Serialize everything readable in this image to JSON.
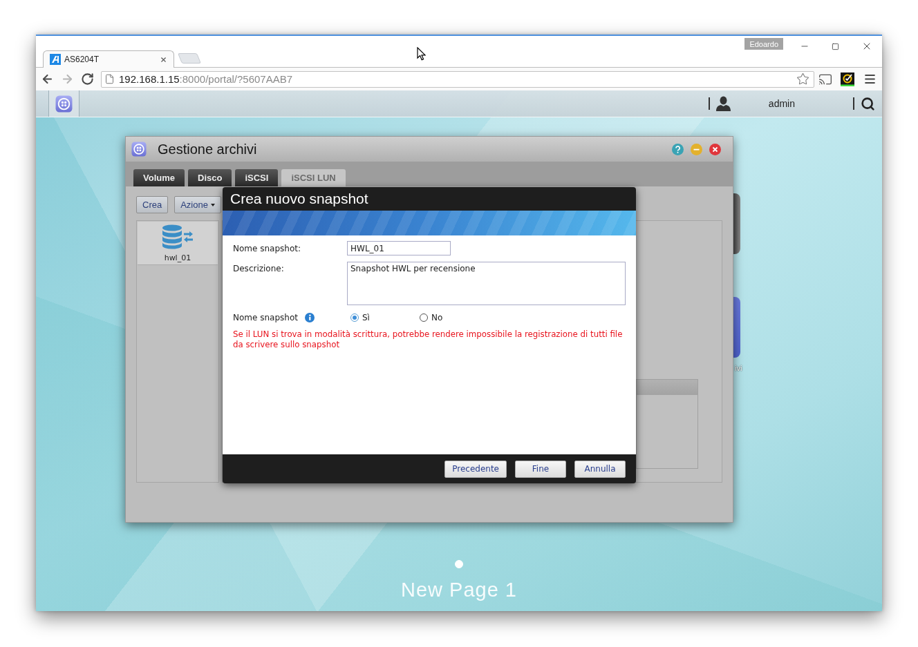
{
  "browser": {
    "tabs": [
      {
        "title": "AS6204T",
        "selected": true
      }
    ],
    "profile": "Edoardo",
    "nav": [
      {
        "kind": "back",
        "disabled": false
      },
      {
        "kind": "forward",
        "disabled": true
      },
      {
        "kind": "reload",
        "disabled": false
      }
    ],
    "url": {
      "host": "192.168.1.15",
      "path": ":8000/portal/?5607AAB7"
    }
  },
  "taskbar": {
    "user": "admin"
  },
  "window": {
    "title": "Gestione archivi",
    "tabs": [
      {
        "label": "Volume",
        "selected": false
      },
      {
        "label": "Disco",
        "selected": false
      },
      {
        "label": "iSCSI",
        "selected": false
      },
      {
        "label": "iSCSI LUN",
        "selected": true
      }
    ],
    "toolbar": [
      {
        "kind": "button",
        "label": "Crea"
      },
      {
        "kind": "menu",
        "label": "Azione"
      }
    ],
    "luns": [
      {
        "name": "hwl_01",
        "selected": true
      }
    ]
  },
  "dialog": {
    "title": "Crea nuovo snapshot",
    "fields": [
      {
        "kind": "input",
        "label": "Nome snapshot:",
        "value": "HWL_01"
      },
      {
        "kind": "textarea",
        "label": "Descrizione:",
        "value": "Snapshot HWL per recensione"
      }
    ],
    "option": {
      "label": "Nome snapshot",
      "choices": [
        {
          "label": "Sì",
          "selected": true
        },
        {
          "label": "No",
          "selected": false
        }
      ]
    },
    "warning": "Se il LUN si trova in modalità scrittura, potrebbe rendere impossibile la registrazione di tutti file da scrivere sullo snapshot",
    "buttons": [
      "Precedente",
      "Fine",
      "Annulla"
    ]
  },
  "desktop": {
    "icon_label": "ivi",
    "pages": [
      {
        "selected": true
      }
    ],
    "page_title": "New Page 1"
  }
}
